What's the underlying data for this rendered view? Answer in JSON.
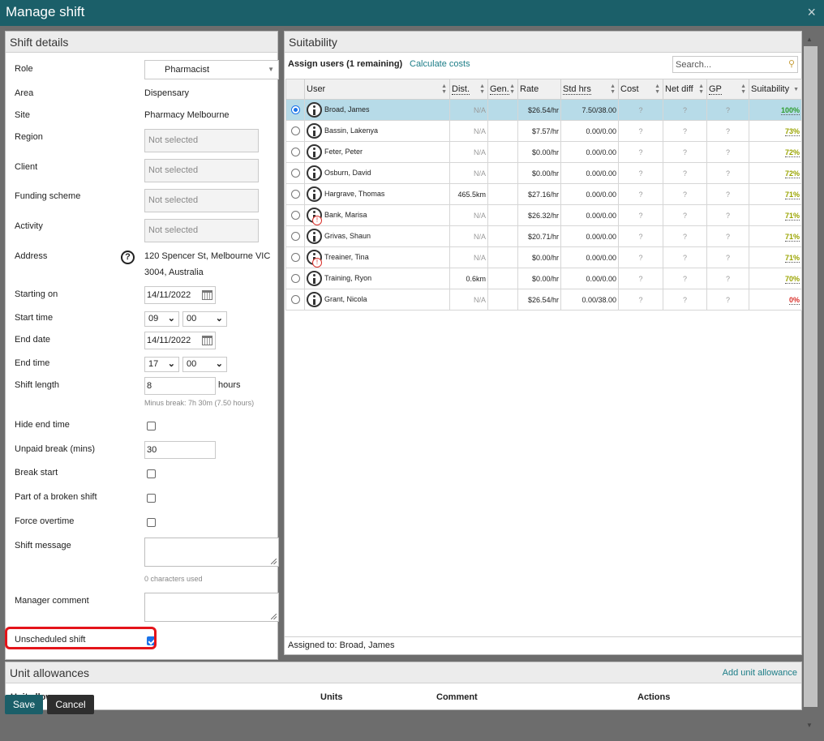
{
  "window": {
    "title": "Manage shift",
    "close_icon": "×"
  },
  "shift_details": {
    "header": "Shift details",
    "role_label": "Role",
    "role_value": "Pharmacist",
    "area_label": "Area",
    "area_value": "Dispensary",
    "site_label": "Site",
    "site_value": "Pharmacy Melbourne",
    "region_label": "Region",
    "region_value": "Not selected",
    "client_label": "Client",
    "client_value": "Not selected",
    "funding_label": "Funding scheme",
    "funding_value": "Not selected",
    "activity_label": "Activity",
    "activity_value": "Not selected",
    "address_label": "Address",
    "address_help": "?",
    "address_line1": "120 Spencer St, Melbourne VIC",
    "address_line2": "3004, Australia",
    "starting_on_label": "Starting on",
    "starting_on_value": "14/11/2022",
    "start_time_label": "Start time",
    "start_hour": "09",
    "start_min": "00",
    "end_date_label": "End date",
    "end_date_value": "14/11/2022",
    "end_time_label": "End time",
    "end_hour": "17",
    "end_min": "00",
    "shift_length_label": "Shift length",
    "shift_length_value": "8",
    "shift_length_unit": "hours",
    "minus_break_hint": "Minus break: 7h 30m (7.50 hours)",
    "hide_end_time_label": "Hide end time",
    "unpaid_break_label": "Unpaid break (mins)",
    "unpaid_break_value": "30",
    "break_start_label": "Break start",
    "broken_shift_label": "Part of a broken shift",
    "force_overtime_label": "Force overtime",
    "shift_message_label": "Shift message",
    "chars_used": "0 characters used",
    "manager_comment_label": "Manager comment",
    "unscheduled_label": "Unscheduled shift",
    "unscheduled_checked": true
  },
  "suitability": {
    "header": "Suitability",
    "assign_label": "Assign users (1 remaining)",
    "calc_link": "Calculate costs",
    "search_placeholder": "Search...",
    "columns": {
      "user": "User",
      "dist": "Dist.",
      "gen": "Gen.",
      "rate": "Rate",
      "std_hrs": "Std hrs",
      "cost": "Cost",
      "net_diff": "Net diff",
      "gp": "GP",
      "suitability": "Suitability"
    },
    "rows": [
      {
        "name": "Broad, James",
        "dist": "N/A",
        "rate": "$26.54/hr",
        "std": "7.50/38.00",
        "cost": "?",
        "net": "?",
        "gp": "?",
        "suit": "100%",
        "color": "#2d9d2d",
        "warn": false,
        "selected": true
      },
      {
        "name": "Bassin, Lakenya",
        "dist": "N/A",
        "rate": "$7.57/hr",
        "std": "0.00/0.00",
        "cost": "?",
        "net": "?",
        "gp": "?",
        "suit": "73%",
        "color": "#9aa400",
        "warn": false,
        "selected": false
      },
      {
        "name": "Feter, Peter",
        "dist": "N/A",
        "rate": "$0.00/hr",
        "std": "0.00/0.00",
        "cost": "?",
        "net": "?",
        "gp": "?",
        "suit": "72%",
        "color": "#9aa400",
        "warn": false,
        "selected": false
      },
      {
        "name": "Osburn, David",
        "dist": "N/A",
        "rate": "$0.00/hr",
        "std": "0.00/0.00",
        "cost": "?",
        "net": "?",
        "gp": "?",
        "suit": "72%",
        "color": "#9aa400",
        "warn": false,
        "selected": false
      },
      {
        "name": "Hargrave, Thomas",
        "dist": "465.5km",
        "rate": "$27.16/hr",
        "std": "0.00/0.00",
        "cost": "?",
        "net": "?",
        "gp": "?",
        "suit": "71%",
        "color": "#9aa400",
        "warn": false,
        "selected": false
      },
      {
        "name": "Bank, Marisa",
        "dist": "N/A",
        "rate": "$26.32/hr",
        "std": "0.00/0.00",
        "cost": "?",
        "net": "?",
        "gp": "?",
        "suit": "71%",
        "color": "#9aa400",
        "warn": true,
        "selected": false
      },
      {
        "name": "Grivas, Shaun",
        "dist": "N/A",
        "rate": "$20.71/hr",
        "std": "0.00/0.00",
        "cost": "?",
        "net": "?",
        "gp": "?",
        "suit": "71%",
        "color": "#9aa400",
        "warn": false,
        "selected": false
      },
      {
        "name": "Treainer, Tina",
        "dist": "N/A",
        "rate": "$0.00/hr",
        "std": "0.00/0.00",
        "cost": "?",
        "net": "?",
        "gp": "?",
        "suit": "71%",
        "color": "#9aa400",
        "warn": true,
        "selected": false
      },
      {
        "name": "Training, Ryon",
        "dist": "0.6km",
        "rate": "$0.00/hr",
        "std": "0.00/0.00",
        "cost": "?",
        "net": "?",
        "gp": "?",
        "suit": "70%",
        "color": "#9aa400",
        "warn": false,
        "selected": false
      },
      {
        "name": "Grant, Nicola",
        "dist": "N/A",
        "rate": "$26.54/hr",
        "std": "0.00/38.00",
        "cost": "?",
        "net": "?",
        "gp": "?",
        "suit": "0%",
        "color": "#d9302a",
        "warn": false,
        "selected": false
      }
    ],
    "assigned_label": "Assigned to:",
    "assigned_value": "Broad, James"
  },
  "unit_allowances": {
    "header": "Unit allowances",
    "add_link": "Add unit allowance",
    "col_allowance": "Unit allowance",
    "col_units": "Units",
    "col_comment": "Comment",
    "col_actions": "Actions"
  },
  "buttons": {
    "save": "Save",
    "cancel": "Cancel"
  },
  "colors": {
    "titlebar": "#1b5f69",
    "link": "#1c7d87",
    "selected_row": "#b7dbe8",
    "highlight": "#e4141a",
    "save_button": "#1b5f69"
  }
}
